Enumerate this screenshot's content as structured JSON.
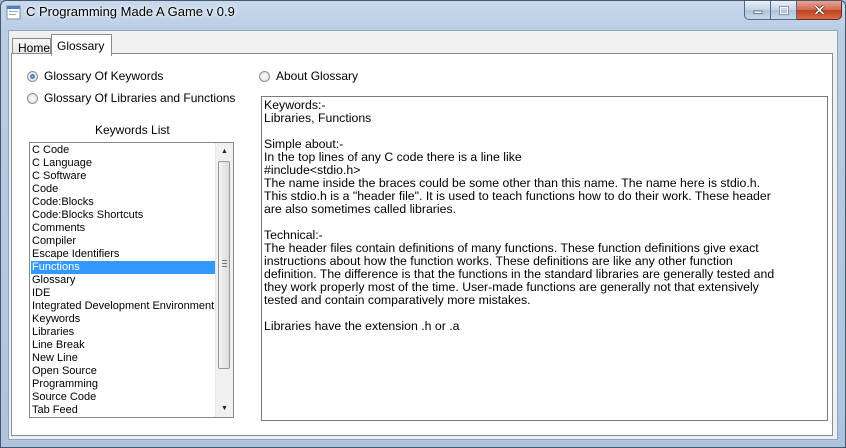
{
  "window": {
    "title": "C Programming Made A Game v 0.9",
    "icon": "app-icon",
    "controls": [
      "minimize-icon",
      "maximize-icon",
      "close-icon"
    ]
  },
  "tabs": [
    {
      "label": "Home",
      "active": false
    },
    {
      "label": "Glossary",
      "active": true
    }
  ],
  "glossary": {
    "radio_keywords": {
      "label": "Glossary Of Keywords",
      "checked": true
    },
    "radio_libraries": {
      "label": "Glossary Of Libraries and Functions",
      "checked": false
    },
    "radio_about": {
      "label": "About Glossary",
      "checked": false
    },
    "list_title": "Keywords List",
    "list_items": [
      "C Code",
      "C Language",
      "C Software",
      "Code",
      "Code:Blocks",
      "Code:Blocks Shortcuts",
      "Comments",
      "Compiler",
      "Escape Identifiers",
      "Functions",
      "Glossary",
      "IDE",
      "Integrated Development Environment",
      "Keywords",
      "Libraries",
      "Line Break",
      "New Line",
      "Open Source",
      "Programming",
      "Source Code",
      "Tab Feed"
    ],
    "selected_item": "Functions",
    "text_lines": [
      "Keywords:-",
      "Libraries, Functions",
      "",
      "Simple about:-",
      "In the top lines of any C code there is a line like",
      "#include<stdio.h>",
      "The name inside the braces could be some other than this name. The name here is stdio.h.",
      "This stdio.h is a \"header file\". It is used to teach functions how to do their work. These header",
      "are also sometimes called libraries.",
      "",
      "Technical:-",
      "The header files contain definitions of many functions. These function definitions give exact",
      "instructions about how the function works. These definitions are like any other function",
      "definition. The difference is that the functions in the standard libraries are generally tested and",
      "they work properly most of the time. User-made functions are generally not that extensively",
      "tested and contain comparatively more mistakes.",
      "",
      "Libraries have the extension .h or .a"
    ]
  }
}
